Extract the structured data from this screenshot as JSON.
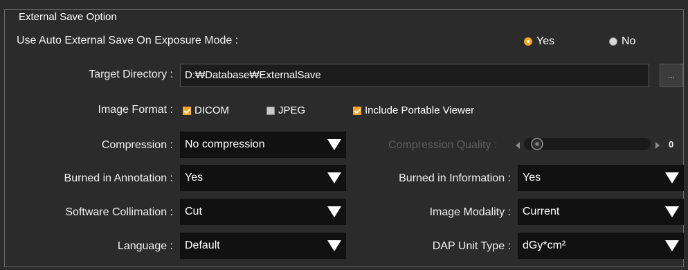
{
  "group_title": "External Save Option",
  "auto_save": {
    "label": "Use Auto External Save On Exposure Mode :",
    "options": [
      {
        "label": "Yes",
        "selected": true
      },
      {
        "label": "No",
        "selected": false
      }
    ]
  },
  "target_directory": {
    "label": "Target Directory :",
    "value": "D:₩Database₩ExternalSave",
    "browse_label": "..."
  },
  "image_format": {
    "label": "Image Format :",
    "options": [
      {
        "label": "DICOM",
        "checked": true
      },
      {
        "label": "JPEG",
        "checked": false
      },
      {
        "label": "Include Portable Viewer",
        "checked": true
      }
    ]
  },
  "compression": {
    "label": "Compression :",
    "value": "No compression"
  },
  "compression_quality": {
    "label": "Compression Quality :",
    "value": "0",
    "level": 0,
    "enabled": false
  },
  "burned_in_annotation": {
    "label": "Burned in Annotation :",
    "value": "Yes"
  },
  "burned_in_information": {
    "label": "Burned in Information :",
    "value": "Yes"
  },
  "software_collimation": {
    "label": "Software Collimation :",
    "value": "Cut"
  },
  "image_modality": {
    "label": "Image Modality :",
    "value": "Current"
  },
  "language": {
    "label": "Language :",
    "value": "Default"
  },
  "dap_unit_type": {
    "label": "DAP Unit Type :",
    "value": "dGy*cm²"
  },
  "colors": {
    "accent": "#f5a623",
    "background": "#2b2b2b",
    "field": "#111111"
  }
}
